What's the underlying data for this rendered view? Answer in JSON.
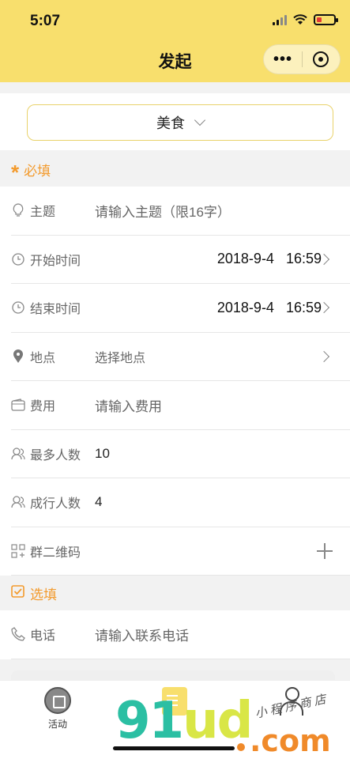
{
  "status_bar": {
    "time": "5:07"
  },
  "header": {
    "title": "发起",
    "more_label": "•••"
  },
  "category": {
    "selected": "美食"
  },
  "required_section": {
    "asterisk": "*",
    "title": "必填"
  },
  "required_rows": [
    {
      "icon": "bulb-icon",
      "label": "主题",
      "placeholder": "请输入主题（限16字）"
    },
    {
      "icon": "clock-icon",
      "label": "开始时间",
      "value": "2018-9-4   16:59"
    },
    {
      "icon": "clock-icon",
      "label": "结束时间",
      "value": "2018-9-4   16:59"
    },
    {
      "icon": "location-icon",
      "label": "地点",
      "placeholder": "选择地点"
    },
    {
      "icon": "wallet-icon",
      "label": "费用",
      "placeholder": "请输入费用"
    },
    {
      "icon": "user-icon",
      "label": "最多人数",
      "value": "10"
    },
    {
      "icon": "user-icon",
      "label": "成行人数",
      "value": "4"
    },
    {
      "icon": "qrcode-icon",
      "label": "群二维码"
    }
  ],
  "optional_section": {
    "title": "选填"
  },
  "optional_rows": [
    {
      "icon": "phone-icon",
      "label": "电话",
      "placeholder": "请输入联系电话"
    }
  ],
  "tabbar": {
    "tabs": [
      {
        "label": "活动",
        "icon": "gift-icon"
      },
      {
        "label": "",
        "icon": "document-icon"
      },
      {
        "label": "",
        "icon": "person-icon"
      }
    ]
  },
  "watermark": {
    "brand_left": "91",
    "brand_right": "ud",
    "domain": ".com",
    "cn": "小程序商店"
  },
  "colors": {
    "header": "#f8df6d",
    "accent": "#f39a2c",
    "border": "#e9d26a"
  }
}
